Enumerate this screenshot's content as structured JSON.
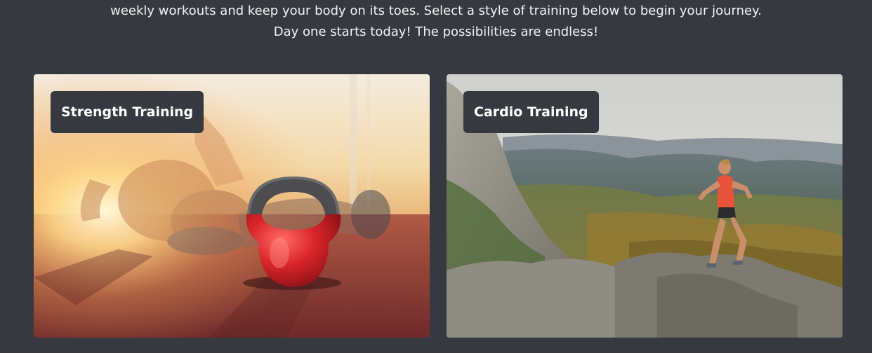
{
  "intro": {
    "line1": "weekly workouts and keep your body on its toes. Select a style of training below to begin your journey.",
    "line2": "Day one starts today! The possibilities are endless!"
  },
  "cards": [
    {
      "label": "Strength Training",
      "image": "kettlebell-sunset-photo"
    },
    {
      "label": "Cardio Training",
      "image": "mountain-runner-photo"
    }
  ],
  "colors": {
    "background": "#363A40",
    "label_background": "#363A40",
    "text": "#FFFFFF"
  }
}
